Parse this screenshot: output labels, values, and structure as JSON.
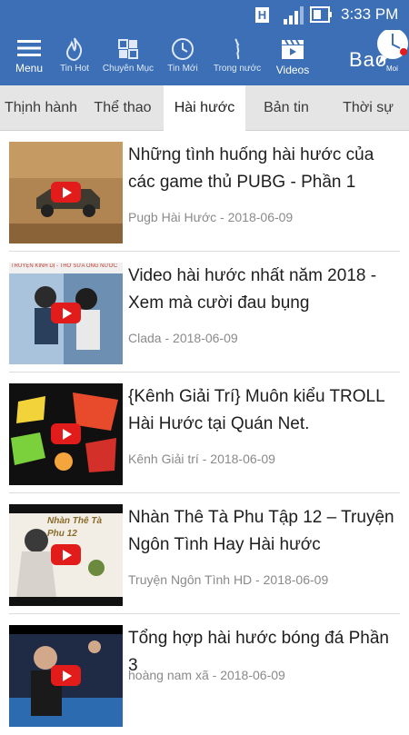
{
  "status_bar": {
    "network": "H",
    "time": "3:33 PM"
  },
  "toolbar": {
    "items": [
      {
        "label": "Menu",
        "icon": "menu-icon"
      },
      {
        "label": "Tin Hot",
        "icon": "flame-icon"
      },
      {
        "label": "Chuyên Mục",
        "icon": "grid-icon"
      },
      {
        "label": "Tin Mới",
        "icon": "clock-icon"
      },
      {
        "label": "Trong nước",
        "icon": "map-icon"
      },
      {
        "label": "Videos",
        "icon": "clapperboard-icon"
      }
    ],
    "brand": {
      "text": "Bao",
      "sub": "Moi"
    }
  },
  "tabs": [
    {
      "label": "Thịnh hành"
    },
    {
      "label": "Thể thao"
    },
    {
      "label": "Hài hước",
      "active": true
    },
    {
      "label": "Bản tin"
    },
    {
      "label": "Thời sự"
    }
  ],
  "videos": [
    {
      "title": "Những tình huống hài hước của các game thủ PUBG - Phần 1",
      "source": "Pugb Hài Hước",
      "date": "2018-06-09"
    },
    {
      "title": "Video hài hước nhất năm 2018 - Xem mà cười đau bụng",
      "source": "Clada",
      "date": "2018-06-09",
      "thumb_text": "TRUYỆN KINH DỊ - THƠ SỮA ÔNG NƯỚC"
    },
    {
      "title": "{Kênh Giải Trí} Muôn kiểu TROLL Hài Hước tại Quán Net.",
      "source": "Kênh Giải trí",
      "date": "2018-06-09"
    },
    {
      "title": "Nhàn Thê Tà Phu Tập 12 – Truyện Ngôn Tình Hay Hài hước",
      "source": "Truyện Ngôn Tình HD",
      "date": "2018-06-09",
      "thumb_text": "Nhàn Thê Tà Phu 12"
    },
    {
      "title": "Tổng hợp hài hước bóng đá Phần 3",
      "source": "hoàng nam xã",
      "date": "2018-06-09"
    }
  ],
  "colors": {
    "header_blue": "#3c6fb5",
    "play_red": "#e21b1b"
  }
}
